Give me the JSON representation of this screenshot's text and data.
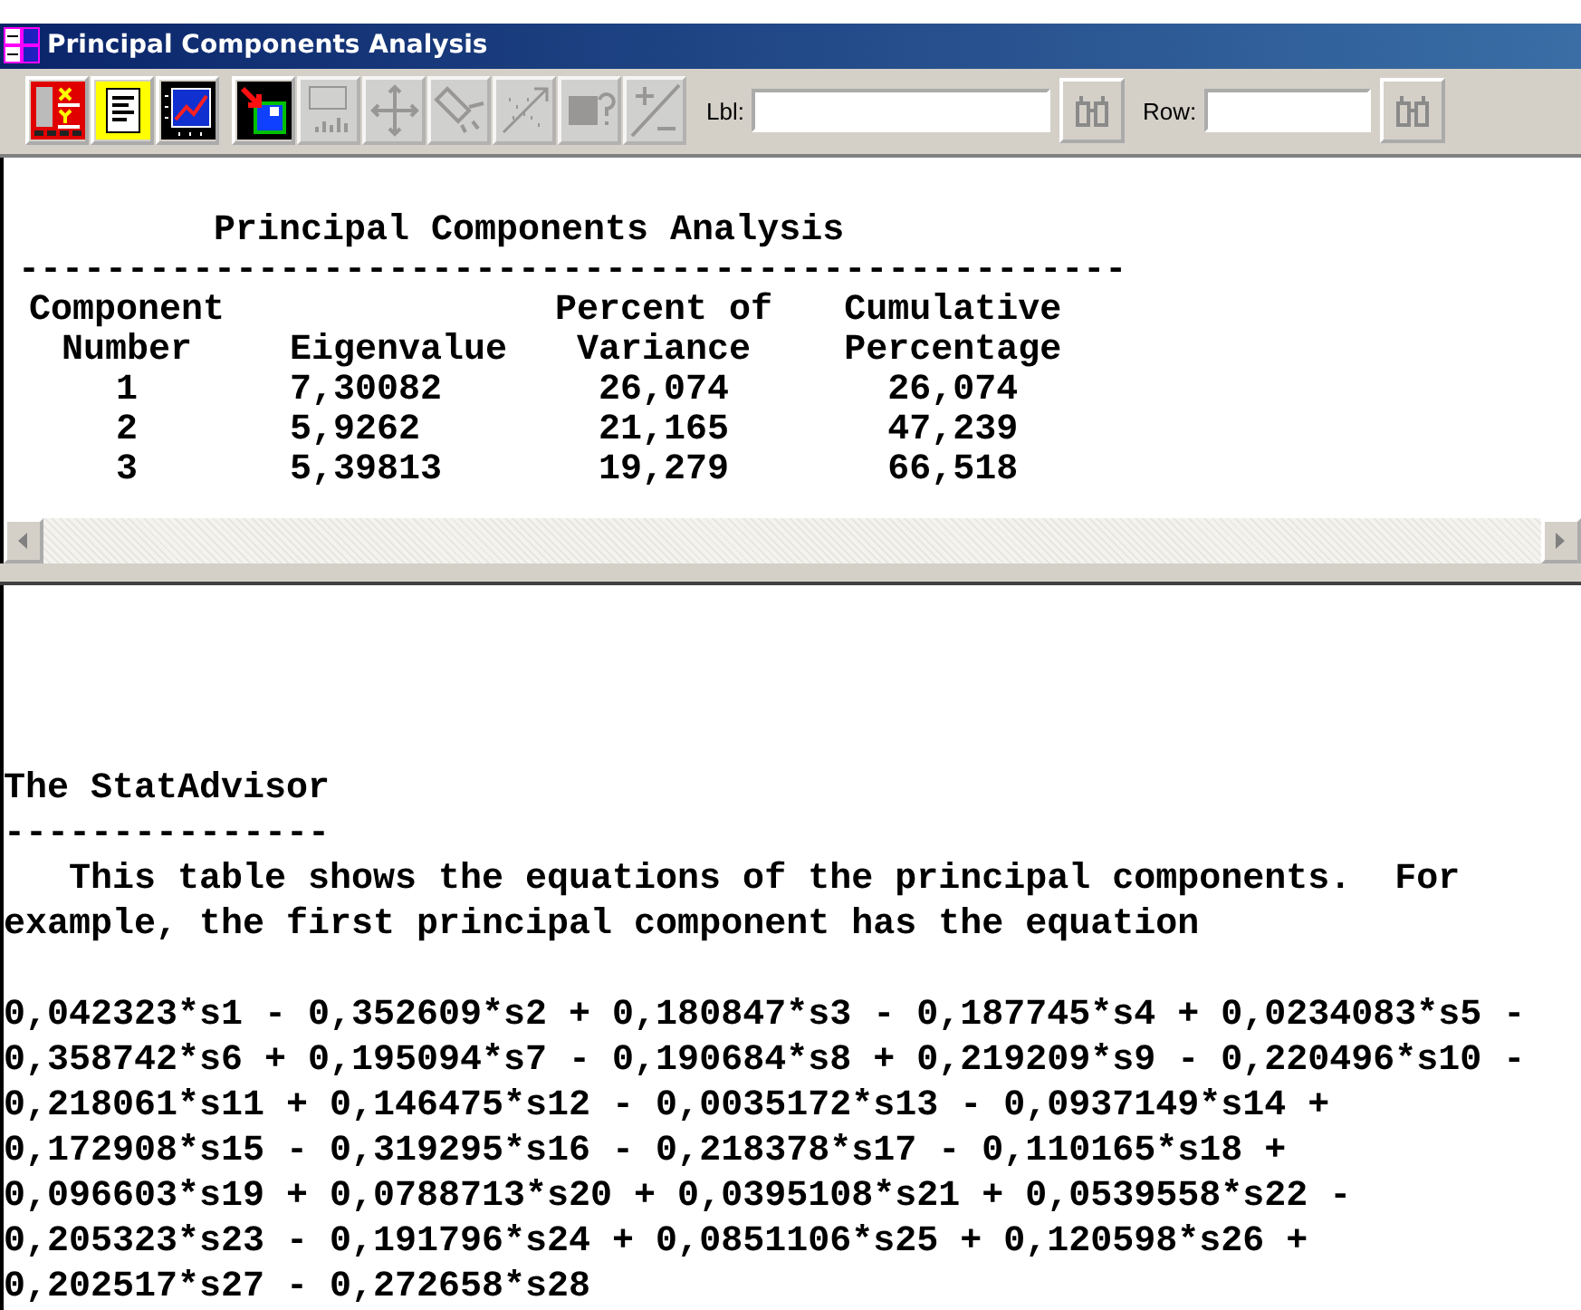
{
  "window": {
    "title": "Principal Components Analysis"
  },
  "toolbar": {
    "buttons": [
      {
        "disabled": false
      },
      {
        "disabled": false
      },
      {
        "disabled": false
      },
      {
        "disabled": false
      },
      {
        "disabled": true
      },
      {
        "disabled": true
      },
      {
        "disabled": true
      },
      {
        "disabled": true
      },
      {
        "disabled": true
      },
      {
        "disabled": true
      }
    ],
    "fields": [
      {
        "label": "Lbl:"
      },
      {
        "label": "Row:"
      }
    ]
  },
  "table_pane": {
    "title": "Principal Components Analysis",
    "rule": "---------------------------------------------------",
    "columns": [
      {
        "heading": [
          "Component",
          "Number"
        ]
      },
      {
        "heading": [
          "Eigenvalue"
        ]
      },
      {
        "heading": [
          "Percent of",
          "Variance"
        ]
      },
      {
        "heading": [
          "Cumulative",
          "Percentage"
        ]
      }
    ],
    "rows": [
      [
        "1",
        "7,30082",
        "26,074",
        "26,074"
      ],
      [
        "2",
        "5,9262",
        "21,165",
        "47,239"
      ],
      [
        "3",
        "5,39813",
        "19,279",
        "66,518"
      ]
    ]
  },
  "advisor_pane": {
    "heading": "The StatAdvisor",
    "rule": "---------------",
    "paragraph": [
      "This table shows the equations of the principal components.  For",
      "example, the first principal component has the equation"
    ],
    "equation": [
      "0,042323*s1 - 0,352609*s2 + 0,180847*s3 - 0,187745*s4 + 0,0234083*s5 -",
      "0,358742*s6 + 0,195094*s7 - 0,190684*s8 + 0,219209*s9 - 0,220496*s10 -",
      "0,218061*s11 + 0,146475*s12 - 0,0035172*s13 - 0,0937149*s14 +",
      "0,172908*s15 - 0,319295*s16 - 0,218378*s17 - 0,110165*s18 +",
      "0,096603*s19 + 0,0788713*s20 + 0,0395108*s21 + 0,0539558*s22 -",
      "0,205323*s23 - 0,191796*s24 + 0,0851106*s25 + 0,120598*s26 +",
      "0,202517*s27 - 0,272658*s28"
    ]
  }
}
